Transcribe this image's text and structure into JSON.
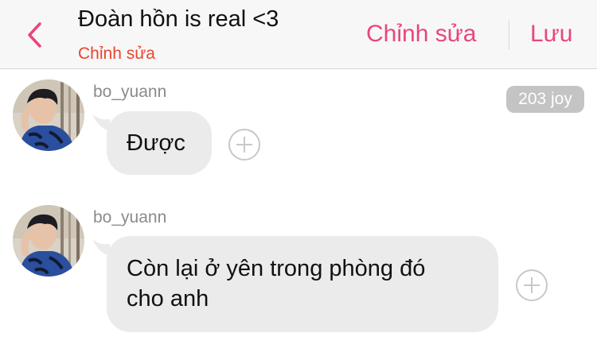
{
  "header": {
    "title": "Đoàn hồn is real <3",
    "subtitle": "Chỉnh sửa",
    "edit_label": "Chỉnh sửa",
    "save_label": "Lưu"
  },
  "colors": {
    "accent": "#e9467a",
    "subtitle": "#e8462d",
    "bubble": "#ebebeb",
    "badge": "#c4c4c4",
    "header_bg": "#f7f7f7"
  },
  "messages": [
    {
      "username": "bo_yuann",
      "text": "Được",
      "badge": "203 joy"
    },
    {
      "username": "bo_yuann",
      "lines": [
        "Còn lại ở yên trong phòng đó",
        "cho anh"
      ]
    }
  ],
  "icons": [
    "back-chevron-icon",
    "add-circle-icon"
  ]
}
